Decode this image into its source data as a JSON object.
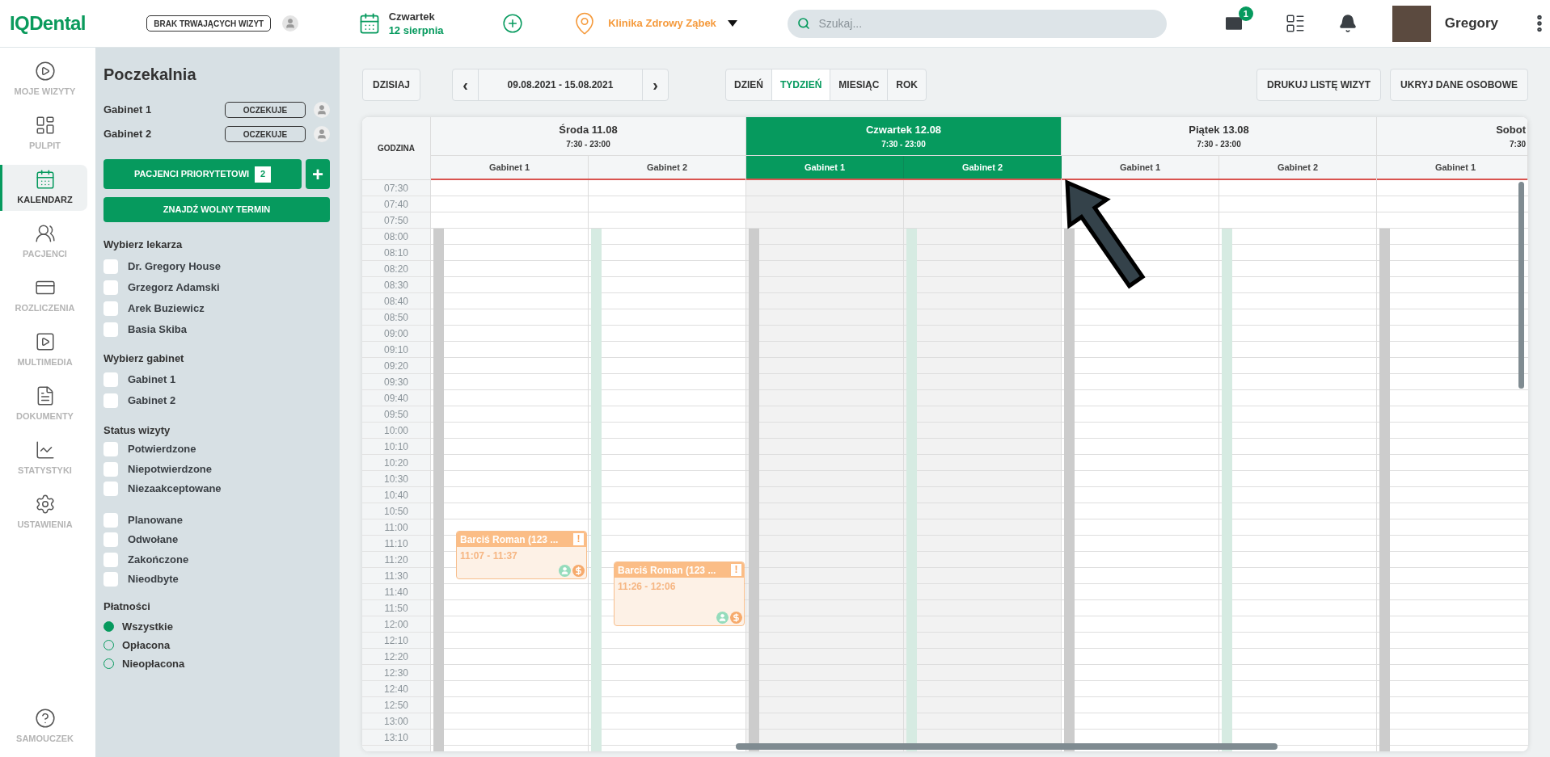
{
  "header": {
    "logo": "IQDental",
    "visit_status": "BRAK TRWAJĄCYCH WIZYT",
    "date": {
      "weekday": "Czwartek",
      "day": "12 sierpnia"
    },
    "clinic": "Klinika Zdrowy Ząbek",
    "search": {
      "placeholder": "Szukaj..."
    },
    "mail_badge": "1",
    "user_name": "Gregory"
  },
  "nav": {
    "items": [
      {
        "label": "MOJE WIZYTY",
        "selected": false
      },
      {
        "label": "PULPIT",
        "selected": false
      },
      {
        "label": "KALENDARZ",
        "selected": true
      },
      {
        "label": "PACJENCI",
        "selected": false
      },
      {
        "label": "ROZLICZENIA",
        "selected": false
      },
      {
        "label": "MULTIMEDIA",
        "selected": false
      },
      {
        "label": "DOKUMENTY",
        "selected": false
      },
      {
        "label": "STATYSTYKI",
        "selected": false
      },
      {
        "label": "USTAWIENIA",
        "selected": false
      }
    ],
    "help": {
      "label": "SAMOUCZEK",
      "selected": false
    }
  },
  "waiting_room": {
    "title": "Poczekalnia",
    "rooms": [
      {
        "name": "Gabinet 1",
        "status": "OCZEKUJE"
      },
      {
        "name": "Gabinet 2",
        "status": "OCZEKUJE"
      }
    ],
    "priority_button": {
      "label": "PACJENCI PRIORYTETOWI",
      "count": "2"
    },
    "add_button": "+",
    "find_button": "ZNAJDŹ WOLNY TERMIN"
  },
  "filters": {
    "doctors": {
      "title": "Wybierz lekarza",
      "items": [
        {
          "label": "Dr. Gregory House",
          "checked": false
        },
        {
          "label": "Grzegorz Adamski",
          "checked": false
        },
        {
          "label": "Arek Buziewicz",
          "checked": false
        },
        {
          "label": "Basia Skiba",
          "checked": false
        }
      ]
    },
    "rooms": {
      "title": "Wybierz gabinet",
      "items": [
        {
          "label": "Gabinet 1",
          "checked": false
        },
        {
          "label": "Gabinet 2",
          "checked": false
        }
      ]
    },
    "status": {
      "title": "Status wizyty",
      "groups": [
        {
          "items": [
            {
              "label": "Potwierdzone",
              "checked": false
            },
            {
              "label": "Niepotwierdzone",
              "checked": false
            },
            {
              "label": "Niezaakceptowane",
              "checked": false
            }
          ]
        },
        {
          "items": [
            {
              "label": "Planowane",
              "checked": false
            },
            {
              "label": "Odwołane",
              "checked": false
            },
            {
              "label": "Zakończone",
              "checked": false
            },
            {
              "label": "Nieodbyte",
              "checked": false
            }
          ]
        }
      ]
    },
    "payments": {
      "title": "Płatności",
      "options": [
        {
          "label": "Wszystkie",
          "selected": true
        },
        {
          "label": "Opłacona",
          "selected": false
        },
        {
          "label": "Nieopłacona",
          "selected": false
        }
      ]
    }
  },
  "toolbar": {
    "today": "DZISIAJ",
    "prev": "‹",
    "range": "09.08.2021 - 15.08.2021",
    "next": "›",
    "views": [
      {
        "label": "DZIEŃ",
        "selected": false
      },
      {
        "label": "TYDZIEŃ",
        "selected": true
      },
      {
        "label": "MIESIĄC",
        "selected": false
      },
      {
        "label": "ROK",
        "selected": false
      }
    ],
    "actions": [
      "DRUKUJ LISTĘ WIZYT",
      "UKRYJ DANE OSOBOWE"
    ]
  },
  "calendar": {
    "time_header": "GODZINA",
    "times": [
      "07:30",
      "07:40",
      "07:50",
      "08:00",
      "08:10",
      "08:20",
      "08:30",
      "08:40",
      "08:50",
      "09:00",
      "09:10",
      "09:20",
      "09:30",
      "09:40",
      "09:50",
      "10:00",
      "10:10",
      "10:20",
      "10:30",
      "10:40",
      "10:50",
      "11:00",
      "11:10",
      "11:20",
      "11:30",
      "11:40",
      "11:50",
      "12:00",
      "12:10",
      "12:20",
      "12:30",
      "12:40",
      "12:50",
      "13:00",
      "13:10"
    ],
    "days": [
      {
        "name": "Środa 11.08",
        "hours": "7:30 - 23:00",
        "selected": false,
        "rooms": [
          {
            "name": "Gabinet 1",
            "appointments": [
              {
                "title": "Barciś Roman (123 ...",
                "time": "11:07 - 11:37",
                "flag": "!"
              }
            ]
          },
          {
            "name": "Gabinet 2",
            "appointments": [
              {
                "title": "Barciś Roman (123 ...",
                "time": "11:26 - 12:06",
                "flag": "!"
              }
            ]
          }
        ]
      },
      {
        "name": "Czwartek 12.08",
        "hours": "7:30 - 23:00",
        "selected": true,
        "rooms": [
          {
            "name": "Gabinet 1"
          },
          {
            "name": "Gabinet 2"
          }
        ]
      },
      {
        "name": "Piątek 13.08",
        "hours": "7:30 - 23:00",
        "selected": false,
        "rooms": [
          {
            "name": "Gabinet 1"
          },
          {
            "name": "Gabinet 2"
          }
        ]
      },
      {
        "name": "Sobot",
        "hours": "7:30",
        "selected": false,
        "rooms": [
          {
            "name": "Gabinet 1"
          }
        ]
      }
    ]
  }
}
